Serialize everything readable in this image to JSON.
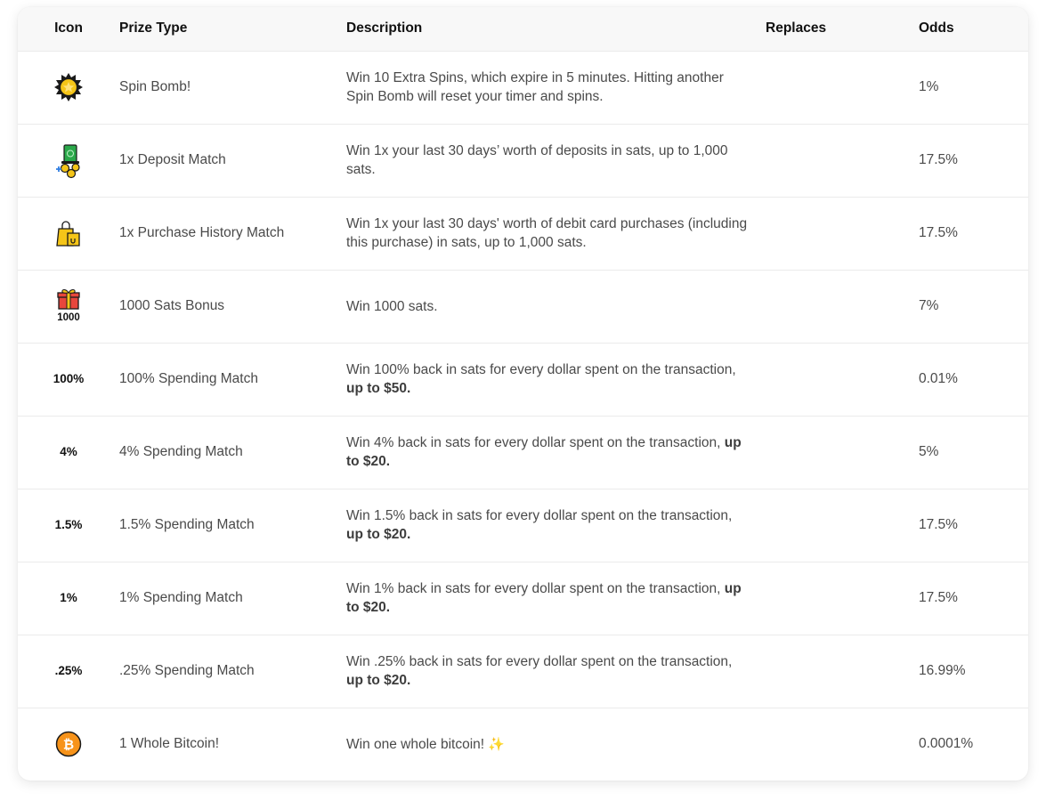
{
  "headers": {
    "icon": "Icon",
    "prize_type": "Prize Type",
    "description": "Description",
    "replaces": "Replaces",
    "odds": "Odds"
  },
  "colors": {
    "header_bg": "#f8f8f8",
    "gold": "#f5c518",
    "bitcoin_orange": "#f7931a",
    "money_green": "#2aa84a",
    "gift_red": "#e8463c",
    "plus_blue": "#2f7de1"
  },
  "rows": [
    {
      "icon": "spin-bomb-icon",
      "prize": "Spin Bomb!",
      "desc_line": "Win 10 Extra Spins, which expire in 5 minutes. Hitting another Spin Bomb will reset your timer and spins.",
      "replaces": "",
      "odds": "1%"
    },
    {
      "icon": "deposit-match-icon",
      "prize": "1x Deposit Match",
      "desc_line": "Win 1x your last 30 days’ worth of deposits in sats, up to 1,000 sats.",
      "replaces": "",
      "odds": "17.5%"
    },
    {
      "icon": "shopping-bags-icon",
      "prize": "1x Purchase History Match",
      "desc_line": "Win 1x your last 30 days' worth of debit card purchases (including this purchase) in sats, up to 1,000 sats.",
      "replaces": "",
      "odds": "17.5%"
    },
    {
      "icon": "gift-icon",
      "icon_label": "1000",
      "prize": "1000 Sats Bonus",
      "desc_line": "Win 1000 sats.",
      "replaces": "",
      "odds": "7%"
    },
    {
      "icon_text": "100%",
      "prize": "100% Spending Match",
      "desc_pre": "Win 100% back in sats for every dollar spent on the transaction, ",
      "desc_bold": "up to $50.",
      "replaces": "",
      "odds": "0.01%"
    },
    {
      "icon_text": "4%",
      "prize": "4% Spending Match",
      "desc_pre": "Win 4% back in sats for every dollar spent on the transaction, ",
      "desc_bold": "up to $20.",
      "replaces": "",
      "odds": "5%"
    },
    {
      "icon_text": "1.5%",
      "prize": "1.5% Spending Match",
      "desc_pre": "Win 1.5% back in sats for every dollar spent on the transaction, ",
      "desc_bold": "up to $20.",
      "replaces": "",
      "odds": "17.5%"
    },
    {
      "icon_text": "1%",
      "prize": "1% Spending Match",
      "desc_pre": "Win 1% back in sats for every dollar spent on the transaction, ",
      "desc_bold": "up to $20.",
      "replaces": "",
      "odds": "17.5%"
    },
    {
      "icon_text": ".25%",
      "prize": ".25% Spending Match",
      "desc_pre": "Win .25% back in sats for every dollar spent on the transaction, ",
      "desc_bold": "up to $20.",
      "replaces": "",
      "odds": "16.99%"
    },
    {
      "icon": "bitcoin-icon",
      "icon_glyph": "₿",
      "prize": "1 Whole Bitcoin!",
      "desc_line": "Win one whole bitcoin!",
      "desc_emoji": "✨",
      "replaces": "",
      "odds": "0.0001%"
    }
  ]
}
